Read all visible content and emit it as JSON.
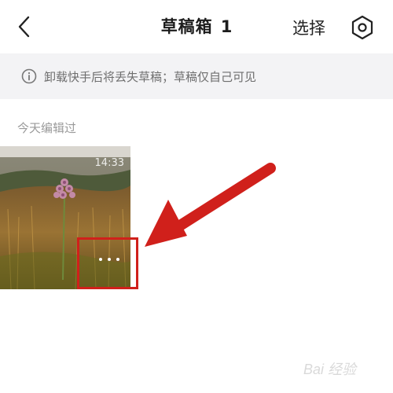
{
  "header": {
    "title": "草稿箱",
    "count": "1",
    "select_label": "选择"
  },
  "notice": {
    "text": "卸载快手后将丢失草稿；草稿仅自己可见"
  },
  "sections": [
    {
      "label": "今天编辑过",
      "drafts": [
        {
          "time": "14:33"
        }
      ]
    }
  ],
  "annotation": {
    "color": "#d0201b"
  },
  "watermark": {
    "text": "Bai 经验"
  },
  "icons": {
    "back": "chevron-left-icon",
    "settings": "gear-hexagon-icon",
    "notice": "info-circle-icon",
    "more": "ellipsis-icon"
  }
}
